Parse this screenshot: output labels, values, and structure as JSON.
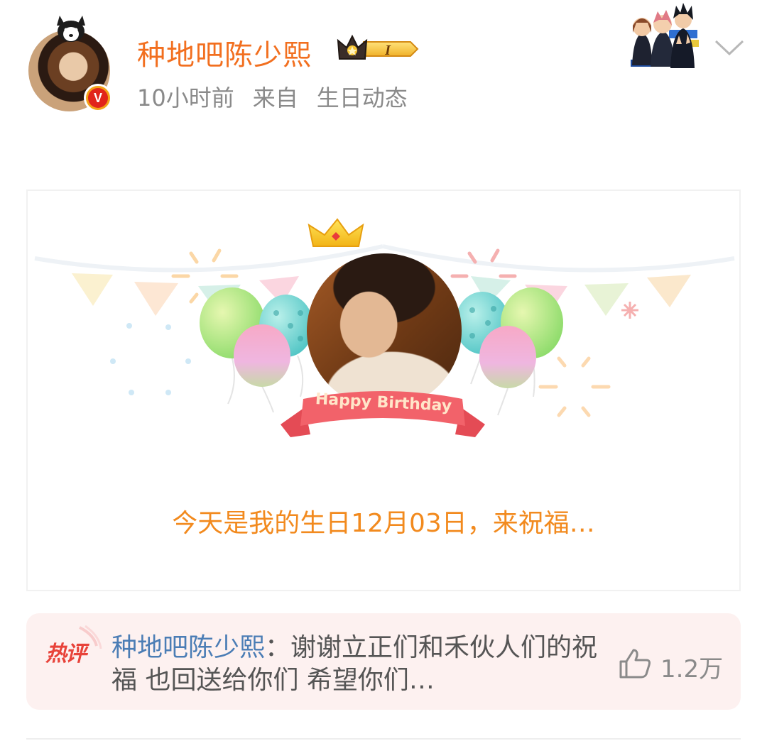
{
  "post": {
    "author": "种地吧陈少熙",
    "time": "10小时前",
    "source_prefix": "来自",
    "source": "生日动态",
    "vip_level": "I",
    "verified_mark": "V"
  },
  "card": {
    "ribbon_text": "Happy Birthday",
    "text": "今天是我的生日12月03日，来祝福…"
  },
  "hot_comment": {
    "tag": "热评",
    "user": "种地吧陈少熙",
    "separator": "：",
    "text": "谢谢立正们和禾伙人们的祝福 也回送给你们 希望你们…",
    "likes": "1.2万"
  },
  "colors": {
    "username": "#f26f1f",
    "card_text": "#f28a1e",
    "hot_user": "#4b7db5",
    "hot_bg": "#fdf1f0"
  },
  "icons": {
    "verified": "verified-v-icon",
    "vip": "crown-vip-icon",
    "more": "chevron-down-icon",
    "like": "thumbs-up-icon"
  }
}
